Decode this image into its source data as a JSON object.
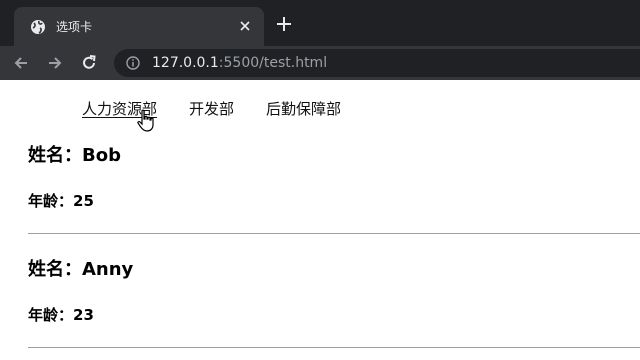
{
  "browser": {
    "tab_title": "选项卡",
    "url_host": "127.0.0.1",
    "url_rest": ":5500/test.html",
    "tab_icon": "globe-icon",
    "colors": {
      "tabstrip": "#202124",
      "toolbar": "#35363a",
      "text": "#e8eaed",
      "muted": "#9aa0a6"
    }
  },
  "nav": {
    "tabs": [
      {
        "label": "人力资源部",
        "active": true
      },
      {
        "label": "开发部",
        "active": false
      },
      {
        "label": "后勤保障部",
        "active": false
      }
    ]
  },
  "people": [
    {
      "name_label": "姓名：",
      "name": "Bob",
      "age_label": "年龄：",
      "age": "25"
    },
    {
      "name_label": "姓名：",
      "name": "Anny",
      "age_label": "年龄：",
      "age": "23"
    }
  ]
}
